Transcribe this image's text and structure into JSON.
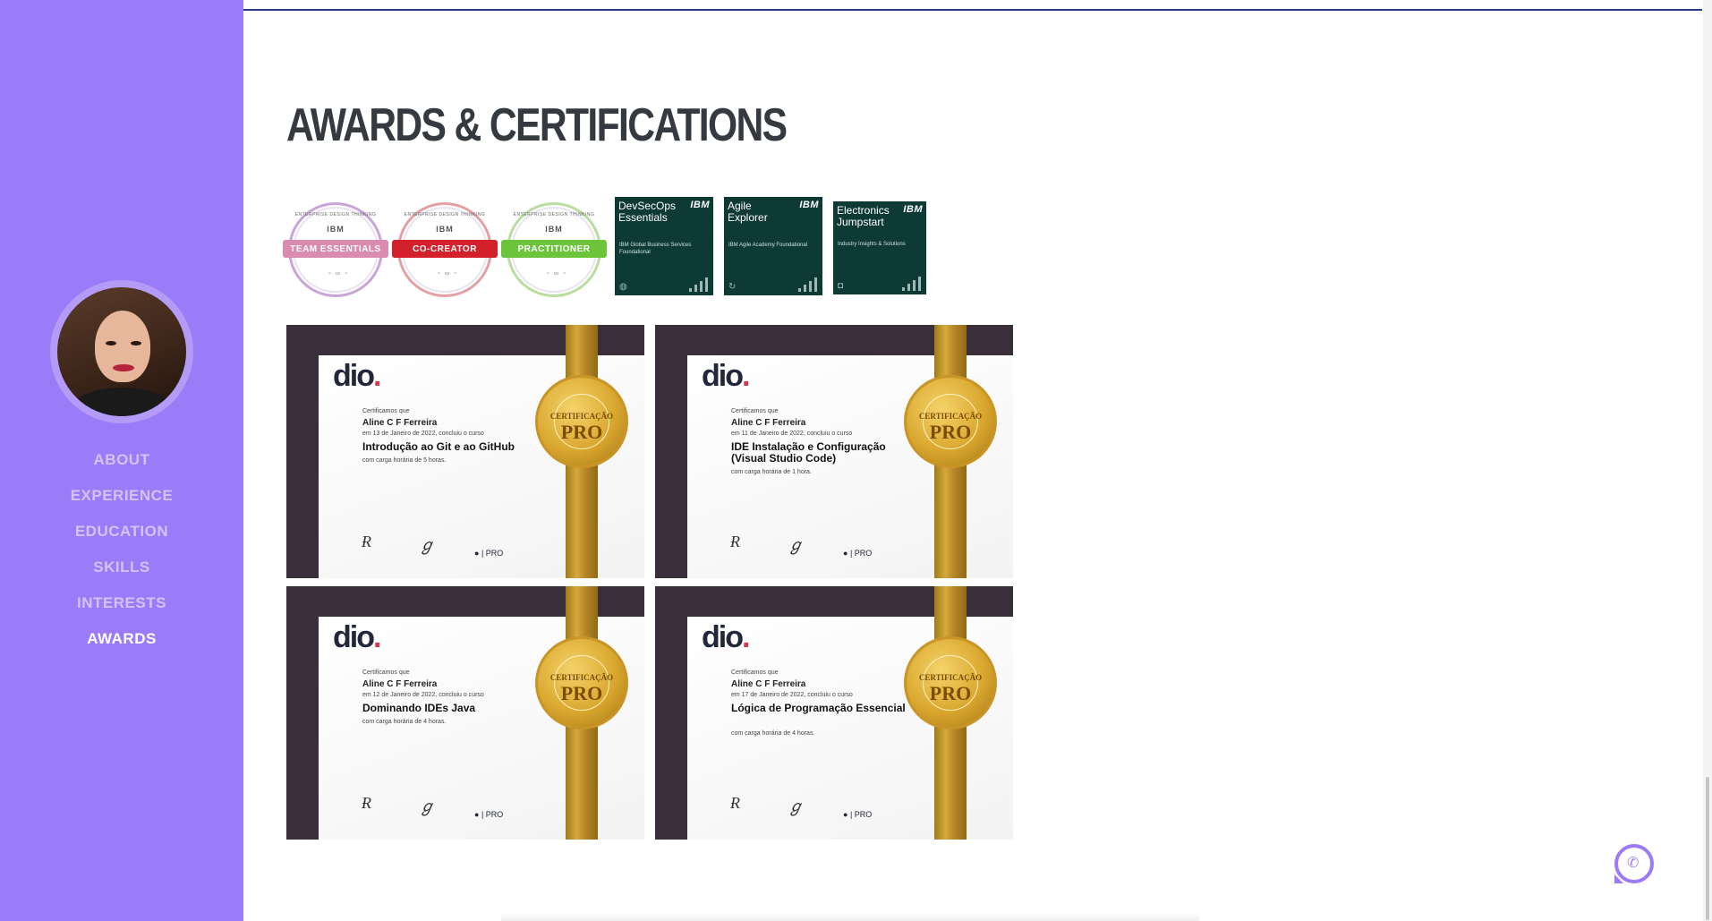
{
  "sidebar": {
    "avatar_alt": "Profile photo",
    "nav": [
      {
        "label": "ABOUT",
        "active": false
      },
      {
        "label": "EXPERIENCE",
        "active": false
      },
      {
        "label": "EDUCATION",
        "active": false
      },
      {
        "label": "SKILLS",
        "active": false
      },
      {
        "label": "INTERESTS",
        "active": false
      },
      {
        "label": "AWARDS",
        "active": true
      }
    ],
    "accent_color": "#9b7bf7"
  },
  "section": {
    "title": "AWARDS & CERTIFICATIONS"
  },
  "badges": {
    "round": [
      {
        "ribbon": "TEAM ESSENTIALS",
        "ibm": "IBM",
        "arc": "ENTERPRISE DESIGN THINKING",
        "color": "#d98bb0"
      },
      {
        "ribbon": "CO-CREATOR",
        "ibm": "IBM",
        "arc": "ENTERPRISE DESIGN THINKING",
        "color": "#d4202b"
      },
      {
        "ribbon": "PRACTITIONER",
        "ibm": "IBM",
        "arc": "ENTERPRISE DESIGN THINKING",
        "color": "#6cc43a"
      }
    ],
    "square": [
      {
        "title": "DevSecOps Essentials",
        "ibm": "IBM",
        "sub": "IBM Global Business Services Foundational"
      },
      {
        "title": "Agile Explorer",
        "ibm": "IBM",
        "sub": "IBM Agile Academy Foundational"
      },
      {
        "title": "Electronics Jumpstart",
        "ibm": "IBM",
        "sub": "Industry Insights & Solutions"
      }
    ]
  },
  "certificates": [
    {
      "logo": "dio",
      "intro": "Certificamos que",
      "name": "Aline C F Ferreira",
      "date": "em 13 de Janeiro de 2022, concluiu o curso",
      "course": "Introdução ao Git e ao GitHub",
      "hours": "com carga horária de 5 horas.",
      "seal_top": "CERTIFICAÇÃO",
      "seal_main": "PRO",
      "pro": "PRO"
    },
    {
      "logo": "dio",
      "intro": "Certificamos que",
      "name": "Aline C F Ferreira",
      "date": "em 11 de Janeiro de 2022, concluiu o curso",
      "course": "IDE Instalação e Configuração (Visual Studio Code)",
      "hours": "com carga horária de 1 hora.",
      "seal_top": "CERTIFICAÇÃO",
      "seal_main": "PRO",
      "pro": "PRO"
    },
    {
      "logo": "dio",
      "intro": "Certificamos que",
      "name": "Aline C F Ferreira",
      "date": "em 12 de Janeiro de 2022, concluiu o curso",
      "course": "Dominando IDEs Java",
      "hours": "com carga horária de 4 horas.",
      "seal_top": "CERTIFICAÇÃO",
      "seal_main": "PRO",
      "pro": "PRO"
    },
    {
      "logo": "dio",
      "intro": "Certificamos que",
      "name": "Aline C F Ferreira",
      "date": "em 17 de Janeiro de 2022, concluiu o curso",
      "course": "Lógica de Programação Essencial",
      "hours": "com carga horária de 4 horas.",
      "seal_top": "CERTIFICAÇÃO",
      "seal_main": "PRO",
      "pro": "PRO"
    }
  ],
  "whatsapp": {
    "icon": "whatsapp-icon"
  }
}
